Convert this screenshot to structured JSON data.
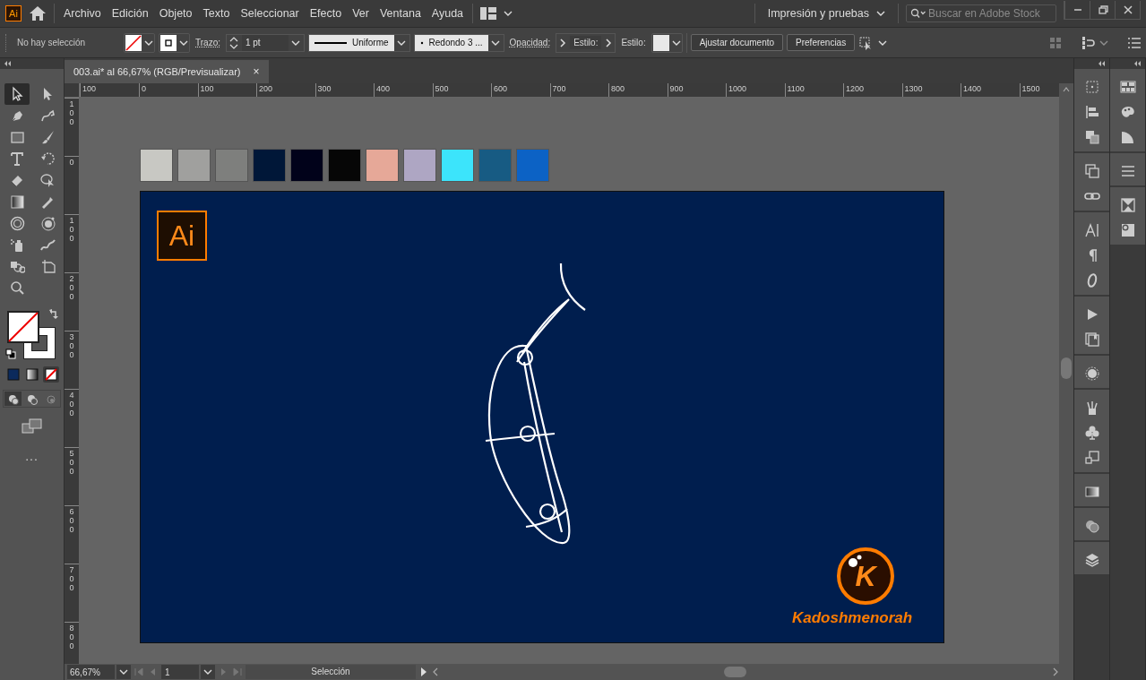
{
  "app_logo": "Ai",
  "menu": [
    "Archivo",
    "Edición",
    "Objeto",
    "Texto",
    "Seleccionar",
    "Efecto",
    "Ver",
    "Ventana",
    "Ayuda"
  ],
  "workspace": "Impresión y pruebas",
  "search": {
    "placeholder": "Buscar en Adobe Stock"
  },
  "control_bar": {
    "selection": "No hay selección",
    "stroke_label": "Trazo:",
    "stroke_weight": "1 pt",
    "profile": "Uniforme",
    "brush": "Redondo 3 ...",
    "opacity_label": "Opacidad:",
    "style_label_1": "Estilo:",
    "style_label_2": "Estilo:",
    "buttons": [
      "Ajustar documento",
      "Preferencias"
    ]
  },
  "tabs": [
    {
      "label": "003.ai* al 66,67% (RGB/Previsualizar)",
      "close": "×",
      "selected": true
    }
  ],
  "tools": [
    {
      "kind": "selection",
      "selected": true
    },
    {
      "kind": "direct",
      "selected": false
    },
    {
      "kind": "pen",
      "selected": false
    },
    {
      "kind": "curvature",
      "selected": false
    },
    {
      "kind": "rect",
      "selected": false
    },
    {
      "kind": "brush",
      "selected": false
    },
    {
      "kind": "type",
      "selected": false
    },
    {
      "kind": "rotate",
      "selected": false
    },
    {
      "kind": "eraser",
      "selected": false
    },
    {
      "kind": "bubble",
      "selected": false
    },
    {
      "kind": "gradient",
      "selected": false
    },
    {
      "kind": "eyedropper",
      "selected": false
    },
    {
      "kind": "target",
      "selected": false
    },
    {
      "kind": "orbit",
      "selected": false
    },
    {
      "kind": "spray",
      "selected": false
    },
    {
      "kind": "squiggle",
      "selected": false
    },
    {
      "kind": "shapes",
      "selected": false
    },
    {
      "kind": "artboard",
      "selected": false
    },
    {
      "kind": "zoom",
      "selected": false
    }
  ],
  "color_modes": [
    {
      "kind": "color",
      "selected": false
    },
    {
      "kind": "gradient",
      "selected": false
    },
    {
      "kind": "none",
      "selected": true
    }
  ],
  "draw_modes": [
    {
      "selected": true
    },
    {
      "selected": false
    },
    {
      "selected": false
    }
  ],
  "more_tools": "...",
  "top_ruler": [
    "100",
    "0",
    "100",
    "200",
    "300",
    "400",
    "500",
    "600",
    "700",
    "800",
    "900",
    "1000",
    "1100",
    "1200",
    "1300",
    "1400",
    "1500"
  ],
  "left_ruler": [
    "100",
    "0",
    "100",
    "200",
    "300",
    "400",
    "500",
    "600",
    "700",
    "800"
  ],
  "swatches": [
    {
      "color": "#c8c8c3"
    },
    {
      "color": "#a0a09e"
    },
    {
      "color": "#7e7f7d"
    },
    {
      "color": "#001738"
    },
    {
      "color": "#01021a"
    },
    {
      "color": "#060606"
    },
    {
      "color": "#e6a898"
    },
    {
      "color": "#aea6c3"
    },
    {
      "color": "#3ce4fb"
    },
    {
      "color": "#175b83"
    },
    {
      "color": "#0c62c5"
    }
  ],
  "artboard": {
    "badge": "Ai",
    "logo_letter": "K",
    "logo_text": "Kadoshmenorah"
  },
  "status_bar": {
    "zoom": "66,67%",
    "artboard_number": "1",
    "tool": "Selección"
  }
}
